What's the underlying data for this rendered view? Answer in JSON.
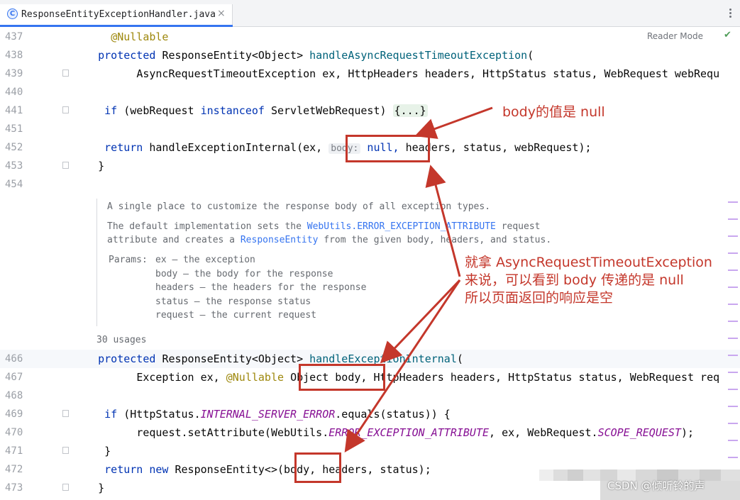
{
  "tab": {
    "icon_letter": "C",
    "title": "ResponseEntityExceptionHandler.java",
    "close": "×"
  },
  "editor": {
    "reader_mode": "Reader Mode",
    "check": "✔"
  },
  "lines": [
    {
      "n": "437"
    },
    {
      "n": "438"
    },
    {
      "n": "439"
    },
    {
      "n": "440"
    },
    {
      "n": "441"
    },
    {
      "n": "451"
    },
    {
      "n": "452"
    },
    {
      "n": "453"
    },
    {
      "n": "454"
    },
    {
      "n": "466"
    },
    {
      "n": "467"
    },
    {
      "n": "468"
    },
    {
      "n": "469"
    },
    {
      "n": "470"
    },
    {
      "n": "471"
    },
    {
      "n": "472"
    },
    {
      "n": "473"
    }
  ],
  "code": {
    "l437_ann": "@Nullable",
    "l438_kw": "protected",
    "l438_type": "ResponseEntity<Object>",
    "l438_fn": "handleAsyncRequestTimeoutException",
    "l438_paren": "(",
    "l439": "AsyncRequestTimeoutException ex, HttpHeaders headers, HttpStatus status, WebRequest webRequ",
    "l441_kw": "if",
    "l441_a": "(webRequest",
    "l441_kw2": "instanceof",
    "l441_b": "ServletWebRequest)",
    "l441_fold": "{...}",
    "l452_kw": "return",
    "l452_a": "handleExceptionInternal(ex,",
    "l452_hint": "body:",
    "l452_null": "null,",
    "l452_b": "headers, status, webRequest);",
    "l453": "}",
    "l466_kw": "protected",
    "l466_type": "ResponseEntity<Object>",
    "l466_fn": "handleExceptionInternal",
    "l466_paren": "(",
    "l467_a": "Exception ex,",
    "l467_ann": "@Nullable",
    "l467_b": "Object body,",
    "l467_c": "HttpHeaders headers, HttpStatus status, WebRequest req",
    "l469_kw": "if",
    "l469_a": "(HttpStatus.",
    "l469_const": "INTERNAL_SERVER_ERROR",
    "l469_b": ".equals(status)) {",
    "l470_a": "request.setAttribute(WebUtils.",
    "l470_const": "ERROR_EXCEPTION_ATTRIBUTE",
    "l470_b": ", ex, WebRequest.",
    "l470_const2": "SCOPE_REQUEST",
    "l470_c": ");",
    "l471": "}",
    "l472_kw": "return",
    "l472_kw2": "new",
    "l472_a": "ResponseEntity<>(body, headers, status);",
    "l473": "}"
  },
  "doc": {
    "p1": "A single place to customize the response body of all exception types.",
    "p2a": "The default implementation sets the",
    "p2link": "WebUtils.ERROR_EXCEPTION_ATTRIBUTE",
    "p2b": "request",
    "p3a": "attribute and creates a",
    "p3link": "ResponseEntity",
    "p3b": "from the given body, headers, and status.",
    "params_label": "Params:",
    "params": [
      "ex – the exception",
      "body – the body for the response",
      "headers – the headers for the response",
      "status – the response status",
      "request – the current request"
    ],
    "usages": "30 usages"
  },
  "annotations": {
    "note1": "body的值是 null",
    "note2_l1": "就拿 AsyncRequestTimeoutException",
    "note2_l2": "来说，可以看到 body 传递的是 null",
    "note2_l3": "所以页面返回的响应是空"
  },
  "watermark": {
    "text": "CSDN @倾听铃的声"
  },
  "colors": {
    "annotation_red": "#c4372b",
    "keyword": "#0033b3",
    "function": "#00627a",
    "annotation_yellow": "#9e880d",
    "constant": "#871094"
  }
}
